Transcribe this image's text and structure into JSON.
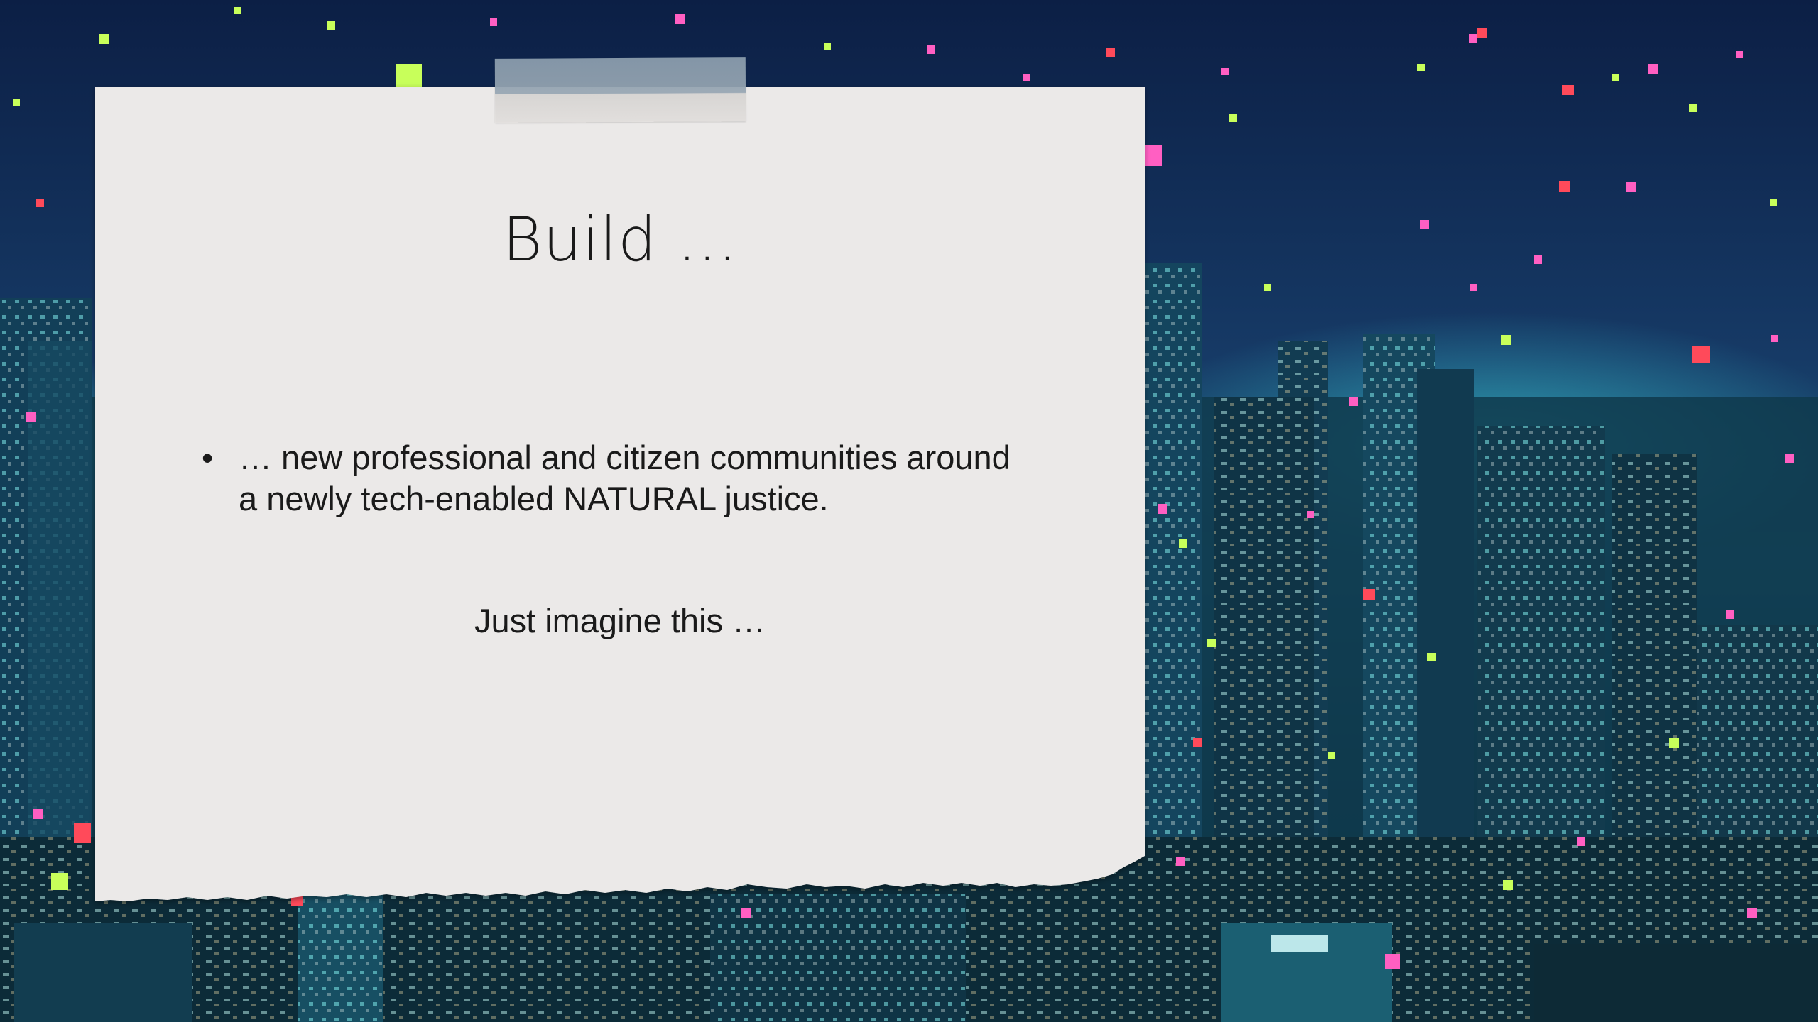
{
  "slide": {
    "title": "Build ...",
    "bullets": [
      "… new professional and citizen communities around a newly tech-enabled NATURAL justice."
    ],
    "subtext": "Just imagine this …",
    "bullet_symbol": "•"
  },
  "colors": {
    "paper": "#ebe9e8",
    "sky": "#0e2a55",
    "city_glow": "#1f9fb0",
    "confetti_pink": "#ff5fc2",
    "confetti_green": "#c8ff5a",
    "confetti_red": "#ff4a5a"
  }
}
